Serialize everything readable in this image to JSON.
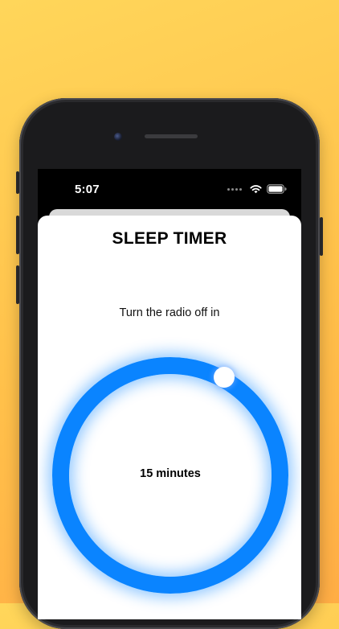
{
  "status_bar": {
    "time": "5:07",
    "wifi_icon": "wifi-icon",
    "battery_icon": "battery-icon"
  },
  "sheet": {
    "title": "SLEEP TIMER",
    "subtitle": "Turn the radio off in",
    "dial_value_label": "15 minutes",
    "dial_color": "#0a84ff"
  }
}
